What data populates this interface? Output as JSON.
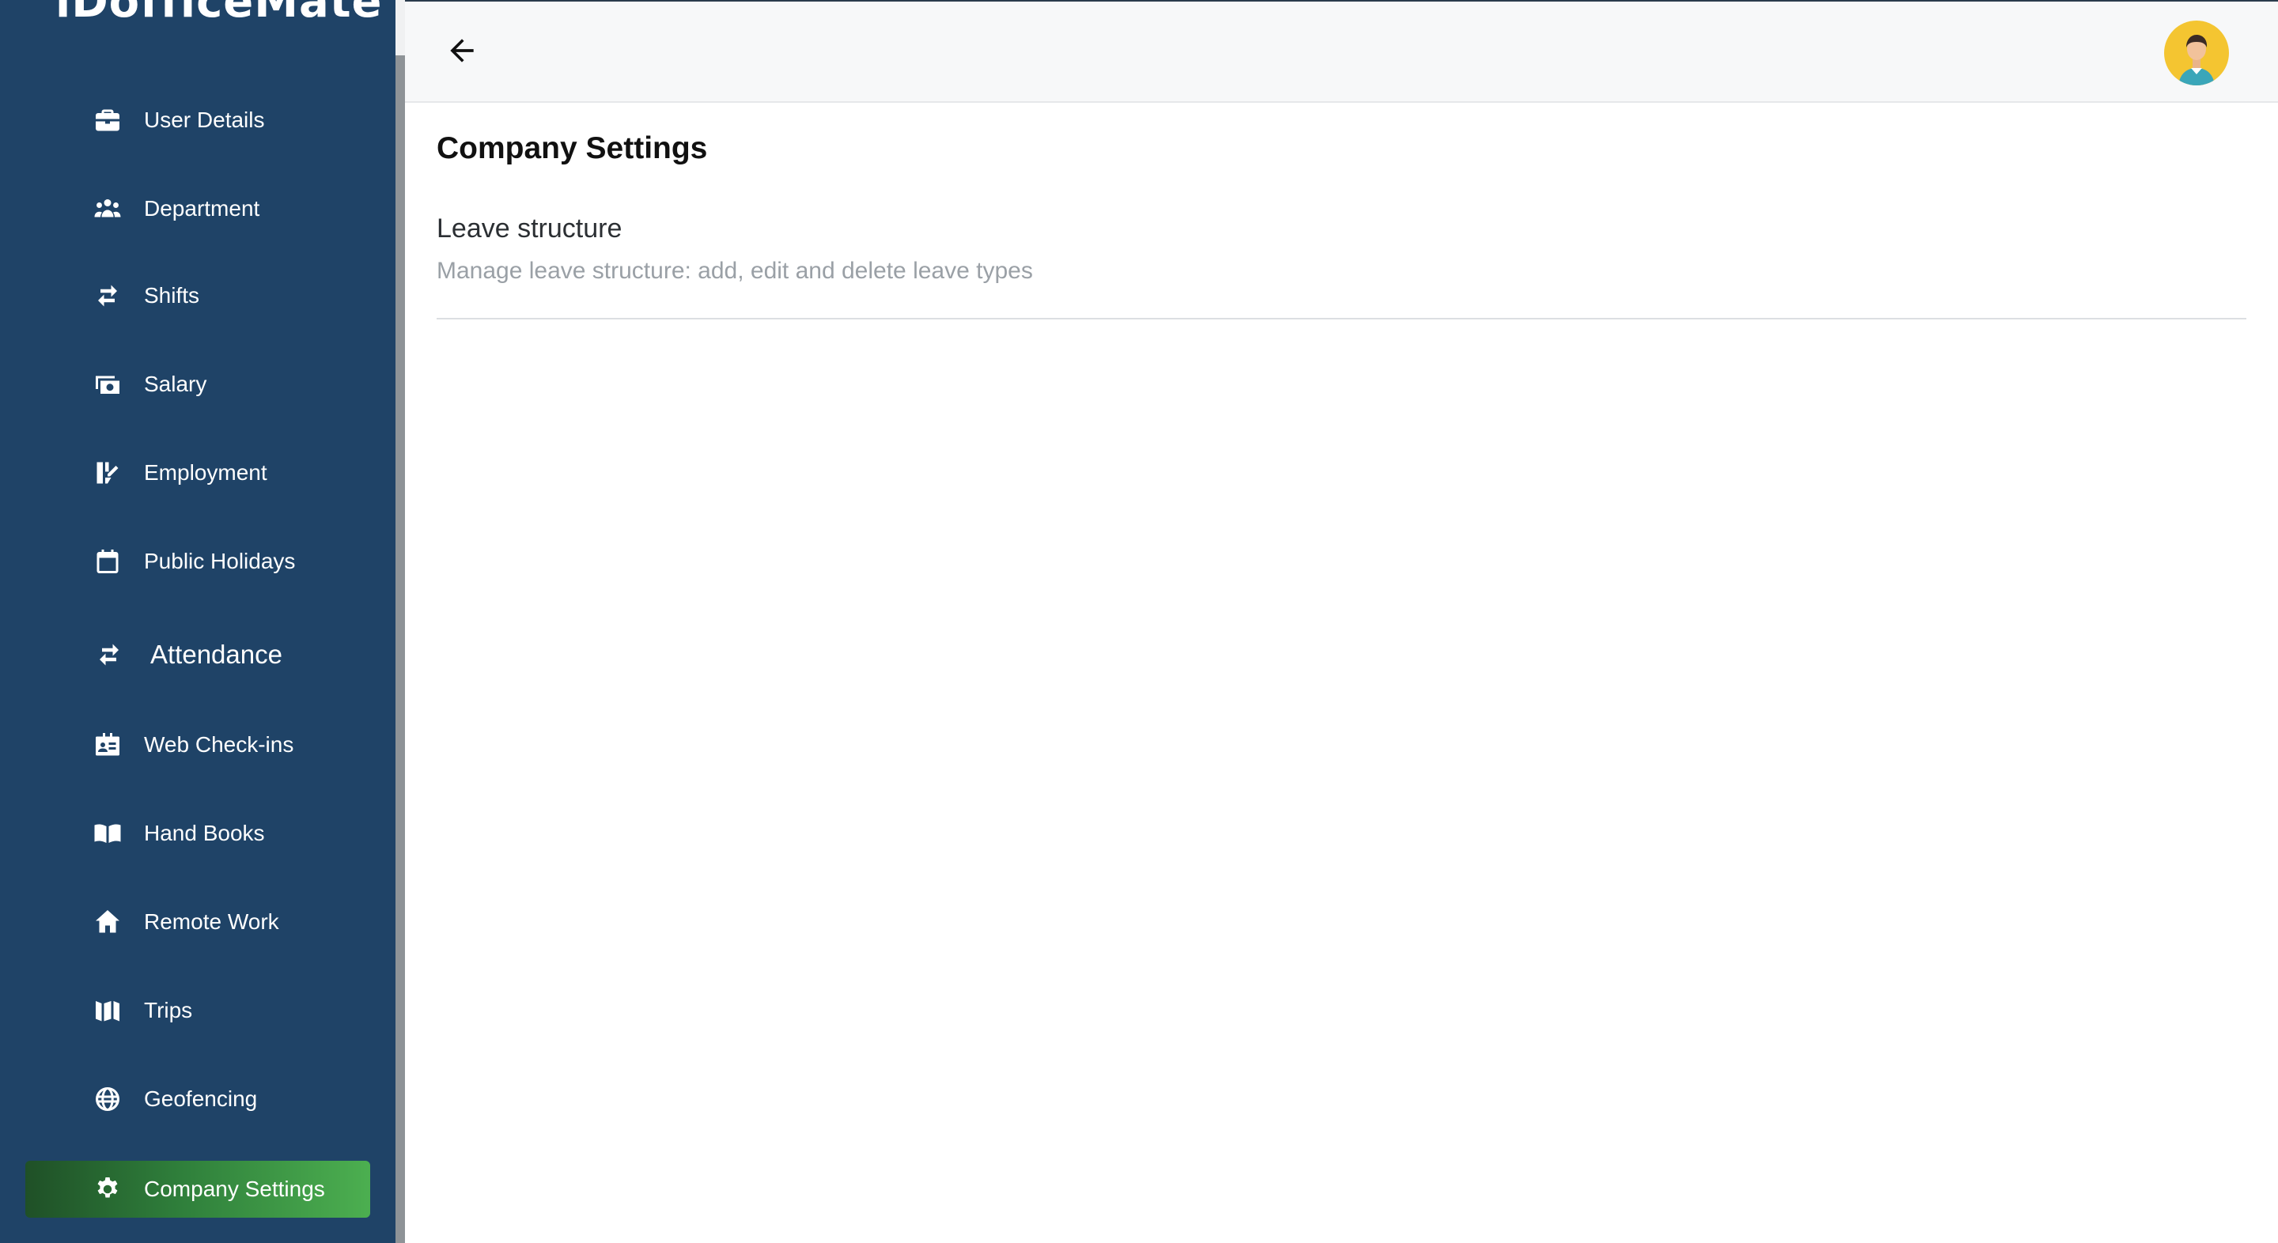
{
  "app": {
    "logo_text": "iDofficeMate"
  },
  "sidebar": {
    "items": [
      {
        "label": "User Details",
        "icon": "briefcase-icon"
      },
      {
        "label": "Department",
        "icon": "users-icon"
      },
      {
        "label": "Shifts",
        "icon": "swap-arrows-icon"
      },
      {
        "label": "Salary",
        "icon": "money-icon"
      },
      {
        "label": "Employment",
        "icon": "employment-icon"
      },
      {
        "label": "Public Holidays",
        "icon": "calendar-icon"
      },
      {
        "label": "Attendance",
        "icon": "swap-arrows-icon"
      },
      {
        "label": "Web Check-ins",
        "icon": "id-card-icon"
      },
      {
        "label": "Hand Books",
        "icon": "book-icon"
      },
      {
        "label": "Remote Work",
        "icon": "home-icon"
      },
      {
        "label": "Trips",
        "icon": "map-icon"
      },
      {
        "label": "Geofencing",
        "icon": "globe-icon"
      },
      {
        "label": "Company Settings",
        "icon": "gear-icon",
        "active": true
      }
    ]
  },
  "header": {
    "back_icon": "arrow-left-icon",
    "avatar": "user-avatar"
  },
  "main": {
    "title": "Company Settings",
    "settings": [
      {
        "title": "Leave structure",
        "description": "Manage leave structure: add, edit and delete leave types"
      }
    ]
  },
  "colors": {
    "sidebar_bg": "#1f4367",
    "active_start": "#1f5027",
    "active_end": "#4caf50",
    "avatar_bg": "#f4c531"
  }
}
